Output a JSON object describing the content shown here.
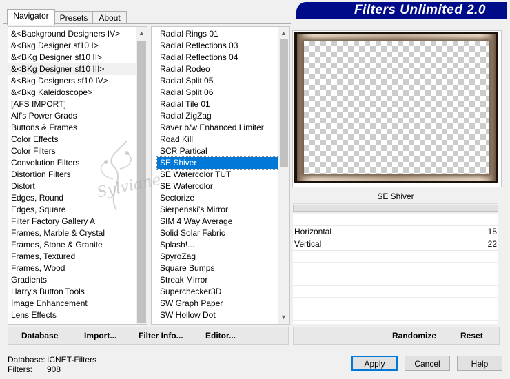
{
  "tabs": [
    {
      "label": "Navigator",
      "active": true
    },
    {
      "label": "Presets",
      "active": false
    },
    {
      "label": "About",
      "active": false
    }
  ],
  "banner": {
    "title": "Filters Unlimited 2.0"
  },
  "categories": [
    "&<Background Designers IV>",
    "&<Bkg Designer sf10 I>",
    "&<BKg Designer sf10 II>",
    "&<BKg Designer sf10 III>",
    "&<Bkg Designers sf10 IV>",
    "&<Bkg Kaleidoscope>",
    "[AFS IMPORT]",
    "Alf's Power Grads",
    "Buttons & Frames",
    "Color Effects",
    "Color Filters",
    "Convolution Filters",
    "Distortion Filters",
    "Distort",
    "Edges, Round",
    "Edges, Square",
    "Filter Factory Gallery A",
    "Frames, Marble & Crystal",
    "Frames, Stone & Granite",
    "Frames, Textured",
    "Frames, Wood",
    "Gradients",
    "Harry's Button Tools",
    "Image Enhancement",
    "Lens Effects"
  ],
  "category_highlight_index": 3,
  "filters": [
    "Radial  Rings 01",
    "Radial Reflections 03",
    "Radial Reflections 04",
    "Radial Rodeo",
    "Radial Split 05",
    "Radial Split 06",
    "Radial Tile 01",
    "Radial ZigZag",
    "Raver b/w Enhanced Limiter",
    "Road Kill",
    "SCR  Partical",
    "SE Shiver",
    "SE Watercolor TUT",
    "SE Watercolor",
    "Sectorize",
    "Sierpenski's Mirror",
    "SIM 4 Way Average",
    "Solid Solar Fabric",
    "Splash!...",
    "SpyroZag",
    "Square Bumps",
    "Streak Mirror",
    "Superchecker3D",
    "SW Graph Paper",
    "SW Hollow Dot"
  ],
  "filter_selected_index": 11,
  "selected_filter_name": "SE Shiver",
  "params": [
    {
      "name": "Horizontal",
      "value": "15"
    },
    {
      "name": "Vertical",
      "value": "22"
    }
  ],
  "lower_buttons": {
    "database": "Database",
    "import": "Import...",
    "filter_info": "Filter Info...",
    "editor": "Editor...",
    "randomize": "Randomize",
    "reset": "Reset"
  },
  "status": {
    "database_label": "Database:",
    "database_value": "ICNET-Filters",
    "filters_label": "Filters:",
    "filters_value": "908"
  },
  "dialog_buttons": {
    "apply": "Apply",
    "cancel": "Cancel",
    "help": "Help"
  },
  "watermark": "Sylviane",
  "colors": {
    "banner": "#000b8a",
    "selection": "#0078d7"
  }
}
